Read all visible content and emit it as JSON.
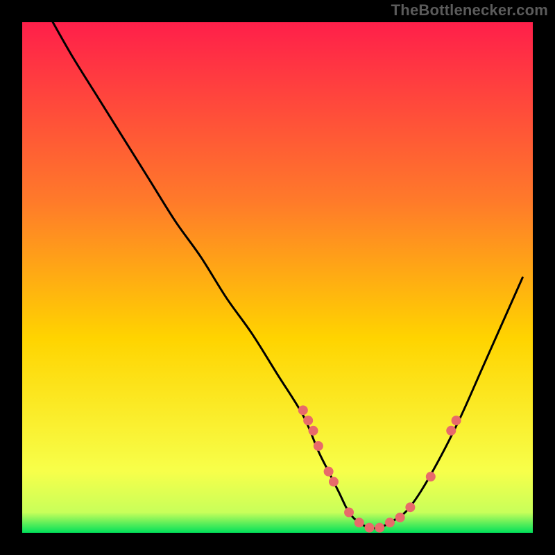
{
  "watermark": "TheBottlenecker.com",
  "colors": {
    "background": "#000000",
    "gradient_top": "#ff1f4a",
    "gradient_mid1": "#ff7a2a",
    "gradient_mid2": "#ffd400",
    "gradient_mid3": "#f7ff4a",
    "gradient_bottom": "#00e05a",
    "curve": "#000000",
    "marker": "#e86a6a"
  },
  "chart_data": {
    "type": "line",
    "title": "",
    "xlabel": "",
    "ylabel": "",
    "xlim": [
      0,
      100
    ],
    "ylim": [
      0,
      100
    ],
    "grid": false,
    "series": [
      {
        "name": "bottleneck-curve",
        "x": [
          6,
          10,
          15,
          20,
          25,
          30,
          35,
          40,
          45,
          50,
          55,
          58,
          60,
          62,
          64,
          66,
          68,
          70,
          72,
          75,
          78,
          82,
          86,
          90,
          94,
          98
        ],
        "y": [
          100,
          93,
          85,
          77,
          69,
          61,
          54,
          46,
          39,
          31,
          23,
          16,
          12,
          8,
          4,
          2,
          1,
          1,
          2,
          4,
          8,
          15,
          23,
          32,
          41,
          50
        ]
      }
    ],
    "markers": {
      "name": "highlight-points",
      "x": [
        55,
        56,
        57,
        58,
        60,
        61,
        64,
        66,
        68,
        70,
        72,
        74,
        76,
        80,
        84,
        85
      ],
      "y": [
        24,
        22,
        20,
        17,
        12,
        10,
        4,
        2,
        1,
        1,
        2,
        3,
        5,
        11,
        20,
        22
      ]
    },
    "annotations": []
  }
}
